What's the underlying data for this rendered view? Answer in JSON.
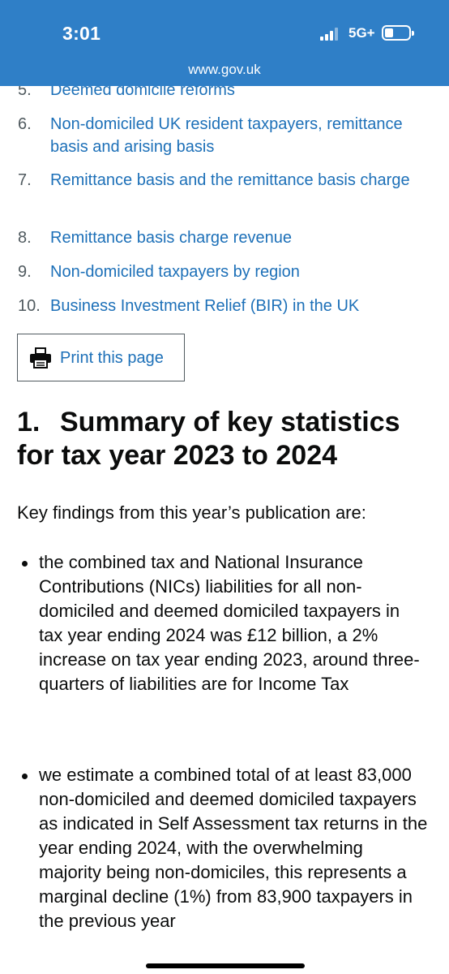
{
  "status_bar": {
    "time": "3:01",
    "network": "5G+",
    "url": "www.gov.uk"
  },
  "contents": {
    "items": [
      {
        "num": "5.",
        "label": "Deemed domicile reforms"
      },
      {
        "num": "6.",
        "label": "Non-domiciled UK resident taxpayers, remittance basis and arising basis"
      },
      {
        "num": "7.",
        "label": "Remittance basis and the remittance basis charge"
      },
      {
        "num": "8.",
        "label": "Remittance basis charge revenue"
      },
      {
        "num": "9.",
        "label": "Non-domiciled taxpayers by region"
      },
      {
        "num": "10.",
        "label": "Business Investment Relief (BIR) in the UK"
      }
    ]
  },
  "print": {
    "label": "Print this page",
    "icon": "printer-icon"
  },
  "section": {
    "number": "1.",
    "title": "Summary of key statistics for tax year 2023 to 2024",
    "intro": "Key findings from this year’s publication are:",
    "bullets": [
      "the combined tax and National Insurance Contributions (NICs) liabilities for all non-domiciled and deemed domiciled taxpayers in tax year ending 2024 was £12 billion, a 2% increase on tax year ending 2023, around three-quarters of liabilities are for Income Tax",
      "we estimate a combined total of at least 83,000 non-domiciled and deemed domiciled taxpayers as indicated in Self Assessment tax returns in the year ending 2024, with the overwhelming majority being non-domiciles, this represents a marginal decline (1%) from 83,900 taxpayers in the previous year"
    ]
  },
  "colors": {
    "header_bg": "#2f7fc7",
    "link": "#1d70b8",
    "text": "#0b0c0c"
  }
}
